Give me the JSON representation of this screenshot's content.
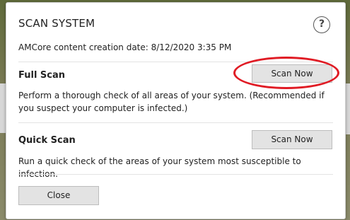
{
  "dialog": {
    "title": "SCAN SYSTEM",
    "help_label": "?",
    "content_date": "AMCore content creation date: 8/12/2020 3:35 PM"
  },
  "full_scan": {
    "title": "Full Scan",
    "button_label": "Scan Now",
    "description": "Perform a thorough check of all areas of your system. (Recommended if you suspect your computer is infected.)"
  },
  "quick_scan": {
    "title": "Quick Scan",
    "button_label": "Scan Now",
    "description": "Run a quick check of the areas of your system most susceptible to infection."
  },
  "footer": {
    "close_label": "Close"
  },
  "annotation": {
    "highlight_color": "#e01b24"
  }
}
